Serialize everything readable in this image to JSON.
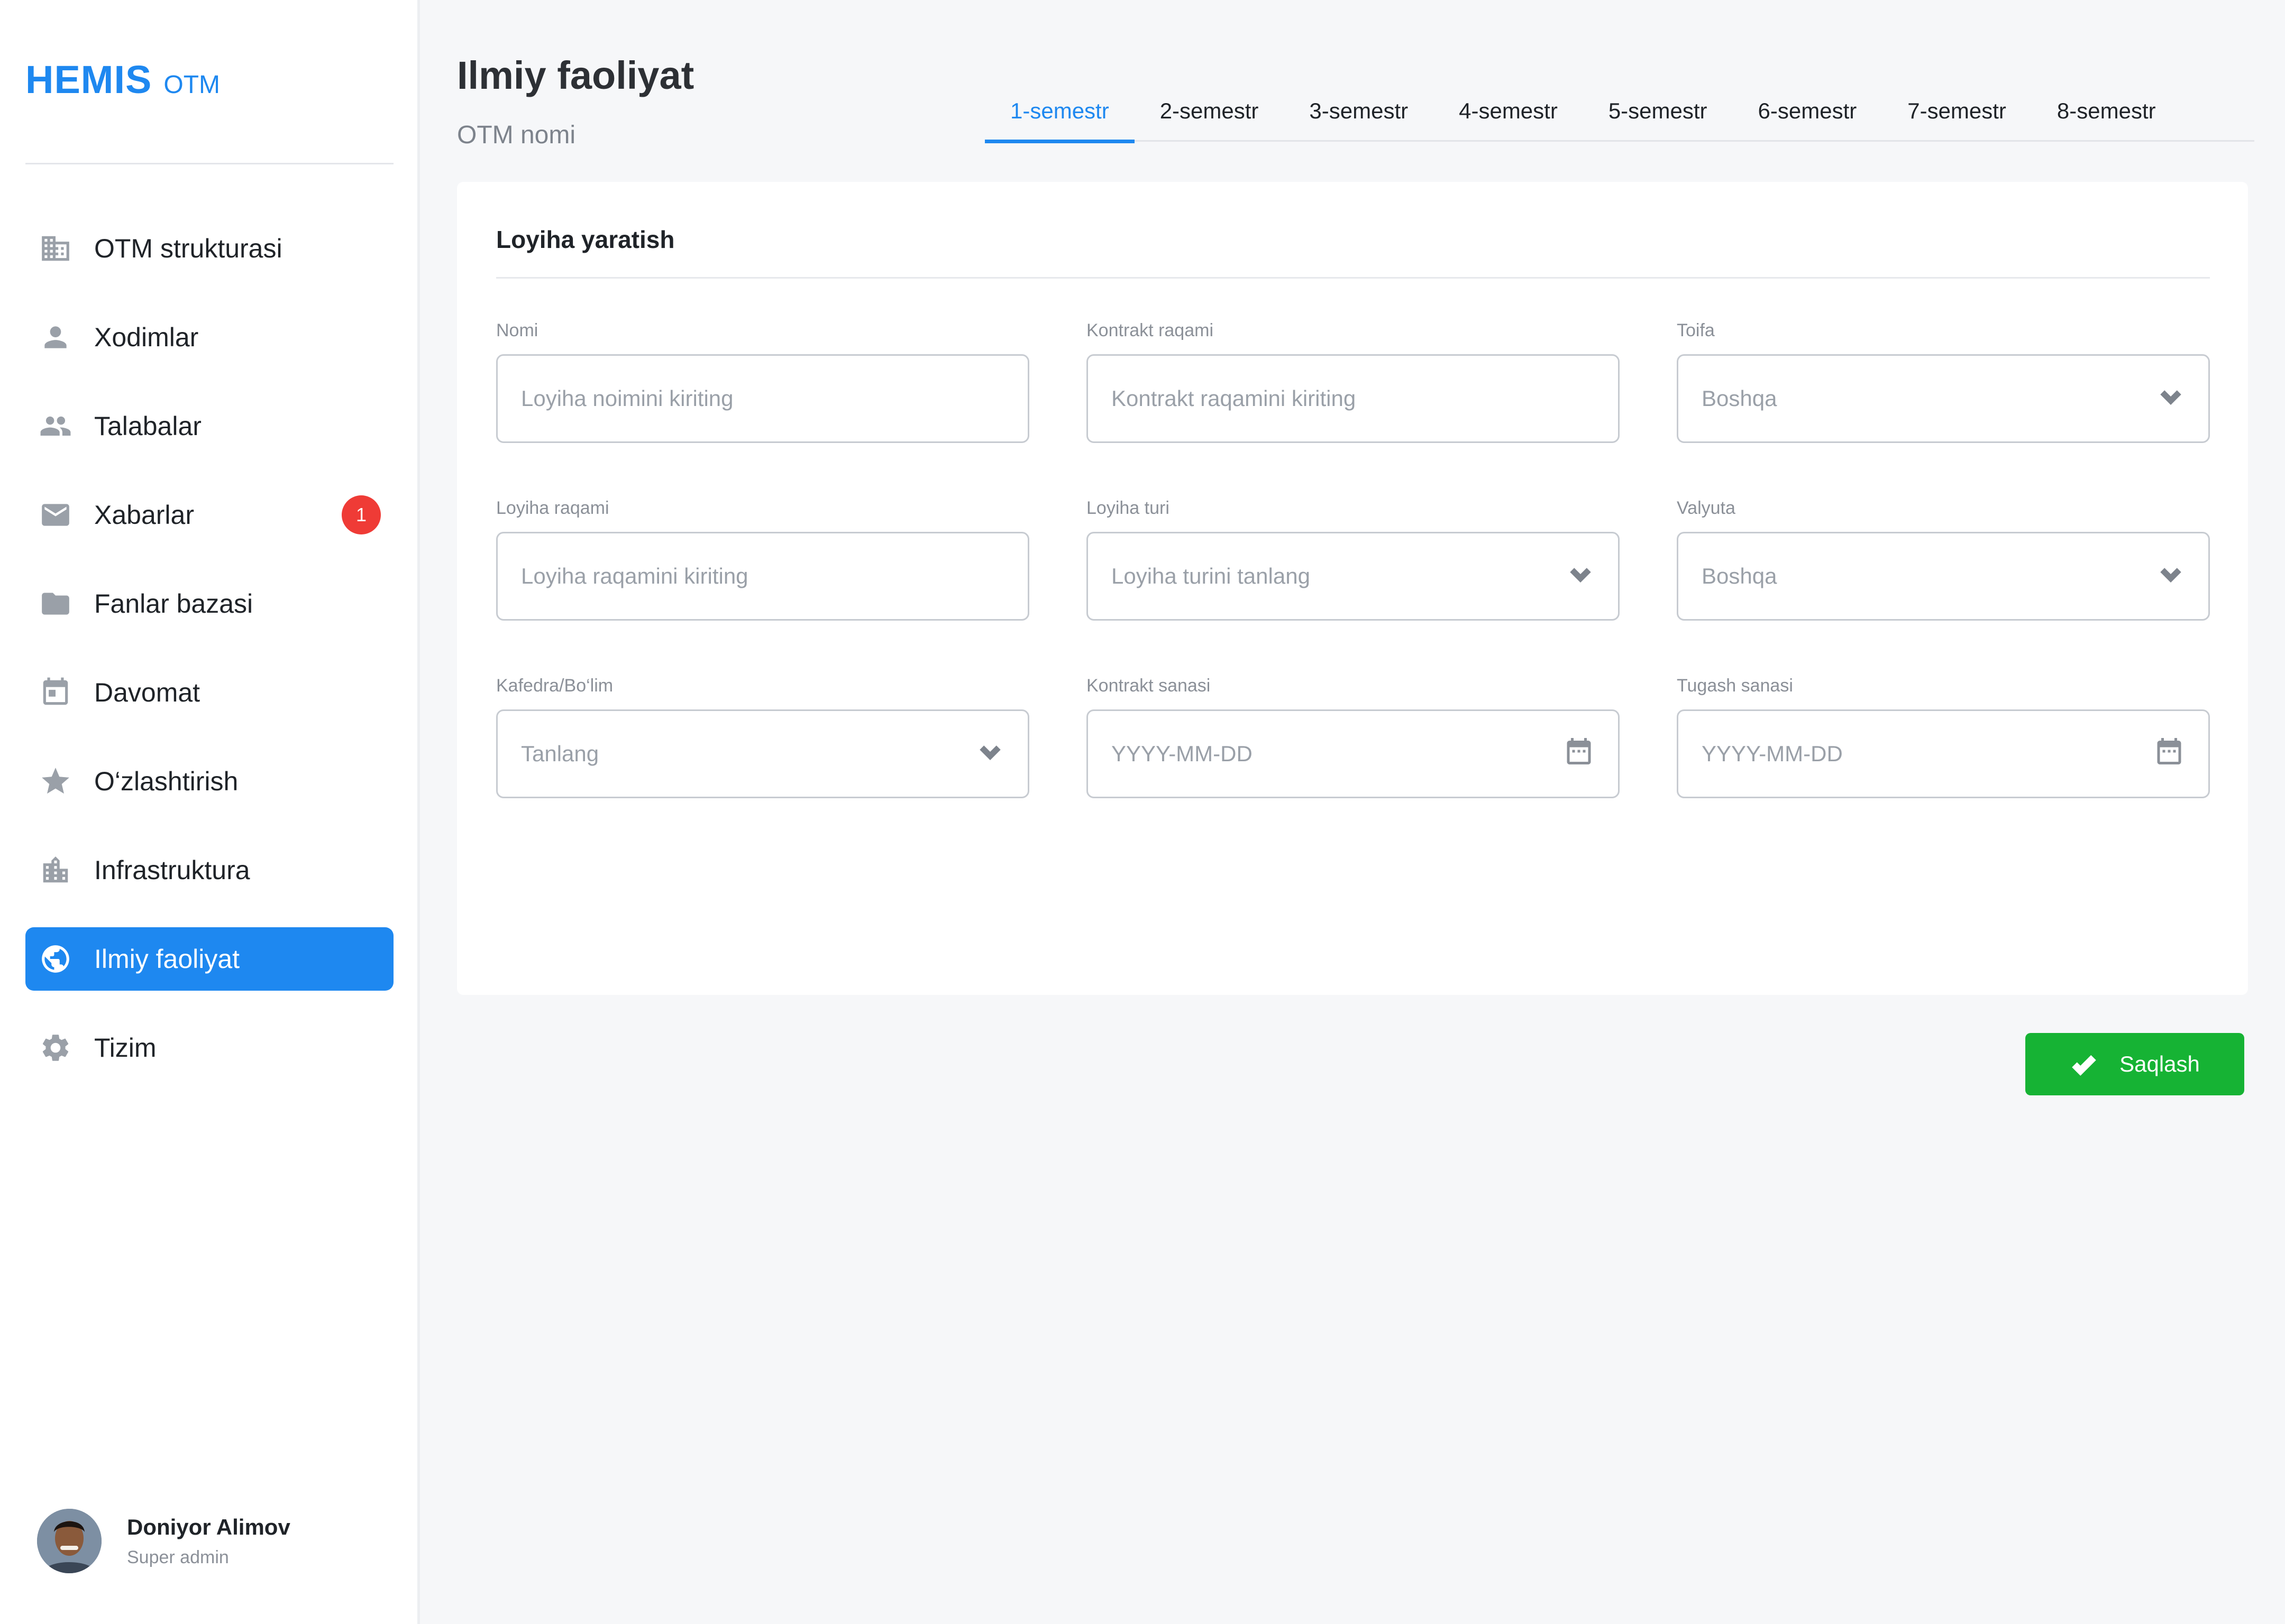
{
  "brand": {
    "name": "HEMIS",
    "suffix": "OTM"
  },
  "sidebar": {
    "items": [
      {
        "label": "OTM strukturasi",
        "icon": "building-icon"
      },
      {
        "label": "Xodimlar",
        "icon": "person-icon"
      },
      {
        "label": "Talabalar",
        "icon": "people-icon"
      },
      {
        "label": "Xabarlar",
        "icon": "mail-icon",
        "badge": "1"
      },
      {
        "label": "Fanlar bazasi",
        "icon": "folder-icon"
      },
      {
        "label": "Davomat",
        "icon": "calendar-icon"
      },
      {
        "label": "O‘zlashtirish",
        "icon": "star-icon"
      },
      {
        "label": "Infrastruktura",
        "icon": "office-building-icon"
      },
      {
        "label": "Ilmiy faoliyat",
        "icon": "globe-icon",
        "active": true
      },
      {
        "label": "Tizim",
        "icon": "gear-icon"
      }
    ]
  },
  "user": {
    "name": "Doniyor Alimov",
    "role": "Super admin"
  },
  "header": {
    "title": "Ilmiy faoliyat",
    "subtitle": "OTM nomi"
  },
  "tabs": [
    "1-semestr",
    "2-semestr",
    "3-semestr",
    "4-semestr",
    "5-semestr",
    "6-semestr",
    "7-semestr",
    "8-semestr"
  ],
  "active_tab": "1-semestr",
  "form": {
    "title": "Loyiha yaratish",
    "fields": {
      "nomi": {
        "label": "Nomi",
        "placeholder": "Loyiha noimini kiriting"
      },
      "kontrakt_raqami": {
        "label": "Kontrakt raqami",
        "placeholder": "Kontrakt raqamini kiriting"
      },
      "toifa": {
        "label": "Toifa",
        "value": "Boshqa"
      },
      "loyiha_raqami": {
        "label": "Loyiha raqami",
        "placeholder": "Loyiha raqamini kiriting"
      },
      "loyiha_turi": {
        "label": "Loyiha turi",
        "value": "Loyiha turini tanlang"
      },
      "valyuta": {
        "label": "Valyuta",
        "value": "Boshqa"
      },
      "kafedra": {
        "label": "Kafedra/Bo‘lim",
        "value": "Tanlang"
      },
      "kontrakt_sanasi": {
        "label": "Kontrakt sanasi",
        "placeholder": "YYYY-MM-DD"
      },
      "tugash_sanasi": {
        "label": "Tugash sanasi",
        "placeholder": "YYYY-MM-DD"
      }
    }
  },
  "actions": {
    "save_label": "Saqlash"
  },
  "colors": {
    "accent": "#1e88f0",
    "success": "#16b334",
    "badge": "#ef3b36"
  }
}
